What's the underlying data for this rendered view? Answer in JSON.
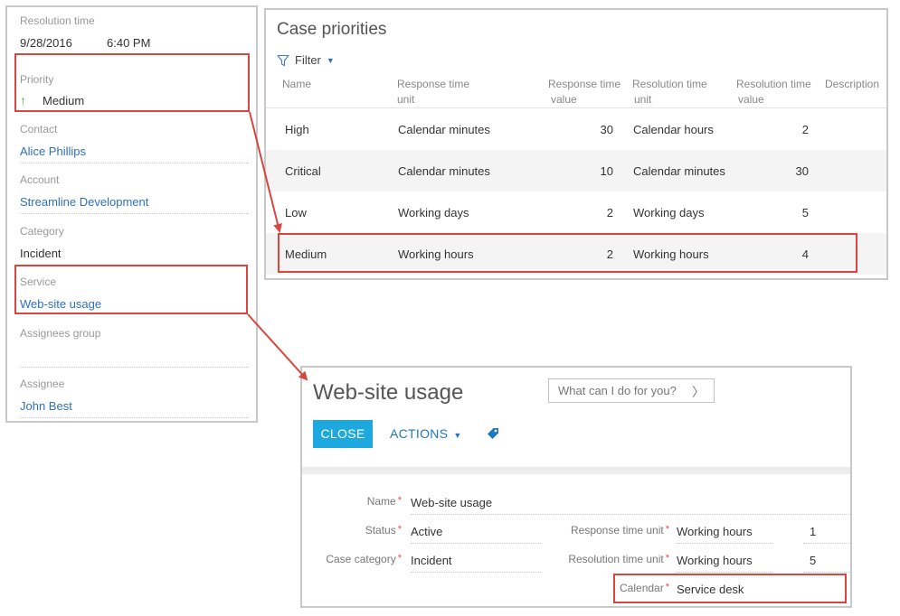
{
  "case_panel": {
    "resolution_time": {
      "label": "Resolution time",
      "date": "9/28/2016",
      "time": "6:40 PM"
    },
    "priority": {
      "label": "Priority",
      "value": "Medium",
      "icon": "arrow-up-icon"
    },
    "contact": {
      "label": "Contact",
      "value": "Alice Phillips"
    },
    "account": {
      "label": "Account",
      "value": "Streamline Development"
    },
    "category": {
      "label": "Category",
      "value": "Incident"
    },
    "service": {
      "label": "Service",
      "value": "Web-site usage"
    },
    "assignees_group": {
      "label": "Assignees group",
      "value": ""
    },
    "assignee": {
      "label": "Assignee",
      "value": "John Best"
    }
  },
  "priorities_panel": {
    "title": "Case priorities",
    "filter_label": "Filter",
    "columns": {
      "name": "Name",
      "response_unit_1": "Response time",
      "response_unit_2": "unit",
      "response_value_1": "Response time",
      "response_value_2": "value",
      "resolution_unit_1": "Resolution time",
      "resolution_unit_2": "unit",
      "resolution_value_1": "Resolution time",
      "resolution_value_2": "value",
      "description": "Description"
    },
    "rows": [
      {
        "name": "High",
        "response_unit": "Calendar minutes",
        "response_value": "30",
        "resolution_unit": "Calendar hours",
        "resolution_value": "2"
      },
      {
        "name": "Critical",
        "response_unit": "Calendar minutes",
        "response_value": "10",
        "resolution_unit": "Calendar minutes",
        "resolution_value": "30"
      },
      {
        "name": "Low",
        "response_unit": "Working days",
        "response_value": "2",
        "resolution_unit": "Working days",
        "resolution_value": "5"
      },
      {
        "name": "Medium",
        "response_unit": "Working hours",
        "response_value": "2",
        "resolution_unit": "Working hours",
        "resolution_value": "4"
      }
    ]
  },
  "service_card": {
    "title": "Web-site usage",
    "search_placeholder": "What can I do for you?",
    "close_label": "CLOSE",
    "actions_label": "ACTIONS",
    "fields": {
      "name": {
        "label": "Name",
        "value": "Web-site usage"
      },
      "status": {
        "label": "Status",
        "value": "Active"
      },
      "case_category": {
        "label": "Case category",
        "value": "Incident"
      },
      "response_time_unit": {
        "label": "Response time unit",
        "value": "Working hours",
        "amount": "1"
      },
      "resolution_time_unit": {
        "label": "Resolution time unit",
        "value": "Working hours",
        "amount": "5"
      },
      "calendar": {
        "label": "Calendar",
        "value": "Service desk"
      }
    },
    "required_mark": "*"
  },
  "colors": {
    "highlight": "#d9453f",
    "link": "#2e6fc6",
    "primary_button": "#1ea8e0",
    "priority_arrow": "#57a85a"
  }
}
